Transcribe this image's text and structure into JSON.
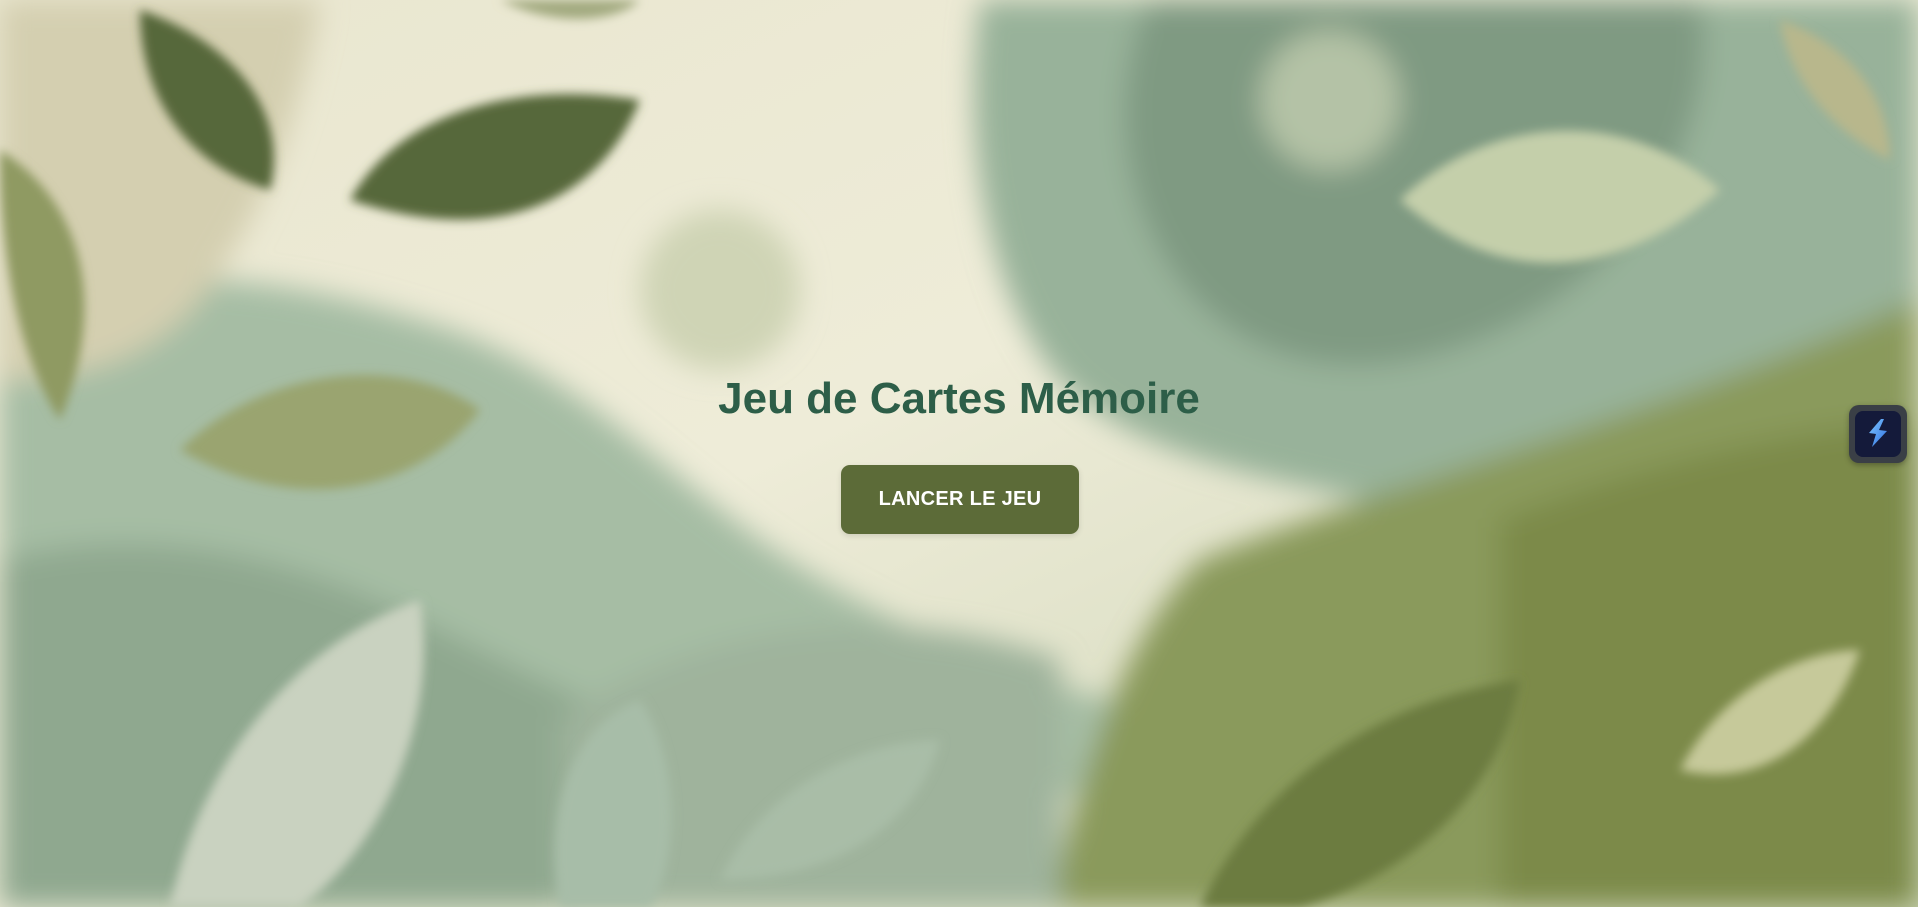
{
  "game": {
    "title": "Jeu de Cartes Mémoire",
    "start_label": "LANCER LE JEU"
  },
  "extension": {
    "icon": "lightning-bolt-icon"
  },
  "colors": {
    "title": "#2d5e48",
    "button": "#5c6b38",
    "button_text": "#ffffff"
  }
}
